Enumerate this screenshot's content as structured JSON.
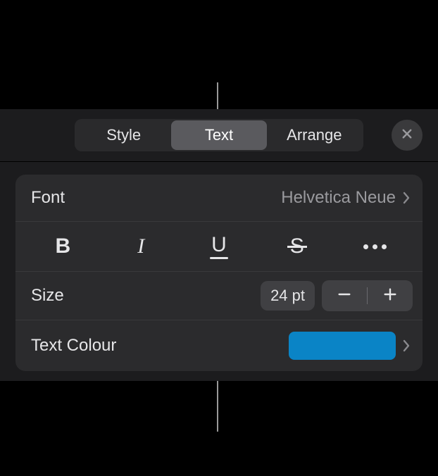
{
  "tabs": {
    "style": "Style",
    "text": "Text",
    "arrange": "Arrange",
    "active": "Text"
  },
  "rows": {
    "font": {
      "label": "Font",
      "value": "Helvetica Neue"
    },
    "size": {
      "label": "Size",
      "value": "24 pt"
    },
    "text_colour": {
      "label": "Text Colour",
      "swatch_hex": "#0a84c6"
    }
  },
  "style_buttons": {
    "bold": "B",
    "italic": "I",
    "underline": "U",
    "strike": "S"
  },
  "colors": {
    "panel_bg": "#1c1c1e",
    "card_bg": "#2b2b2d",
    "pill_bg": "#404043",
    "text_primary": "#e6e6e8",
    "text_secondary": "#9a9a9e"
  }
}
